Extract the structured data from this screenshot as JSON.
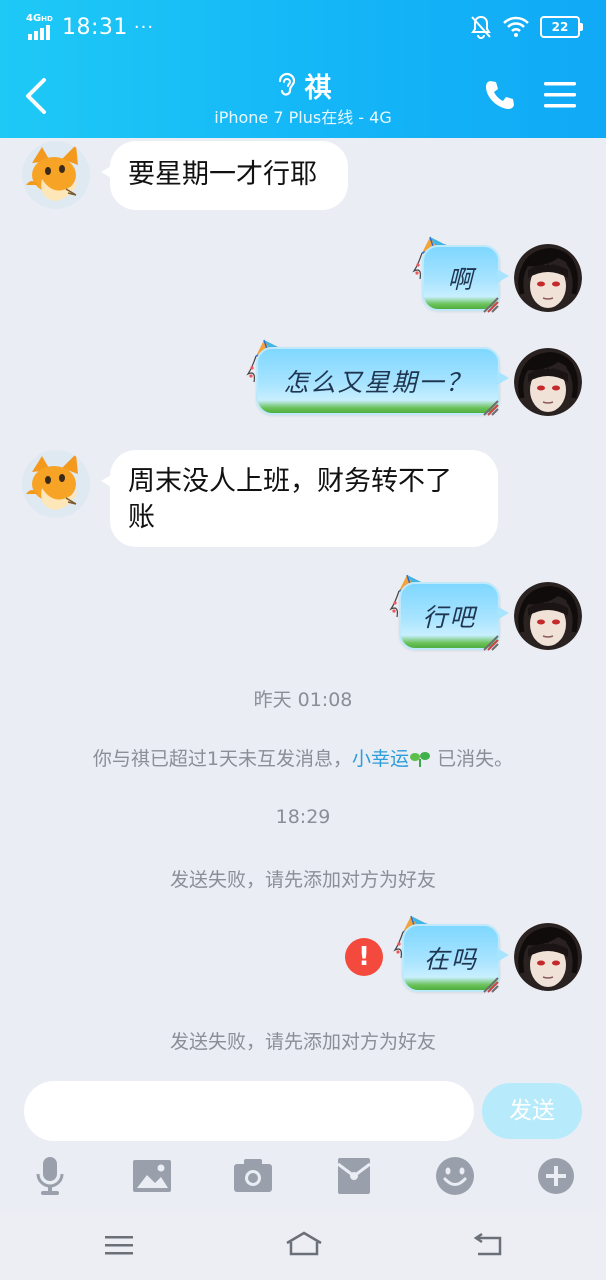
{
  "status_bar": {
    "network": "4G",
    "network_badge": "HD",
    "time": "18:31",
    "more": "···",
    "battery": "22"
  },
  "header": {
    "contact_name": "祺",
    "device_status": "iPhone 7 Plus在线 - 4G"
  },
  "messages": [
    {
      "side": "left",
      "style": "plain",
      "text_lines": [
        "要星期一才行耶"
      ]
    },
    {
      "side": "right",
      "style": "kite",
      "text": "啊"
    },
    {
      "side": "right",
      "style": "kite",
      "text": "怎么又星期一？"
    },
    {
      "side": "left",
      "style": "plain",
      "text_lines": [
        "周末没人上班，财务转不了",
        "账"
      ]
    },
    {
      "side": "right",
      "style": "kite",
      "text": "行吧"
    },
    {
      "side": "right",
      "style": "kite",
      "text": "在吗",
      "failed": true,
      "error_mark": "!"
    }
  ],
  "system": {
    "time1": "昨天 01:08",
    "streak_prefix": "你与祺已超过1天未互发消息，",
    "streak_link": "小幸运",
    "streak_suffix": " 已消失。",
    "time2": "18:29",
    "fail_notice_1": "发送失败，请先添加对方为好友",
    "fail_notice_2": "发送失败，请先添加对方为好友"
  },
  "input": {
    "placeholder": "",
    "send_label": "发送"
  },
  "colors": {
    "header_gradient_start": "#1ec9f6",
    "header_gradient_end": "#10a9f6",
    "chat_background": "#eaedf4",
    "link": "#2d9cdb",
    "error": "#f44a3d",
    "send_button": "#b7ebfb"
  },
  "icons": {
    "toolbar": [
      "microphone-icon",
      "picture-icon",
      "camera-icon",
      "red-packet-icon",
      "emoji-icon",
      "plus-icon"
    ],
    "navbar": [
      "menu-icon",
      "home-icon",
      "back-icon"
    ]
  }
}
